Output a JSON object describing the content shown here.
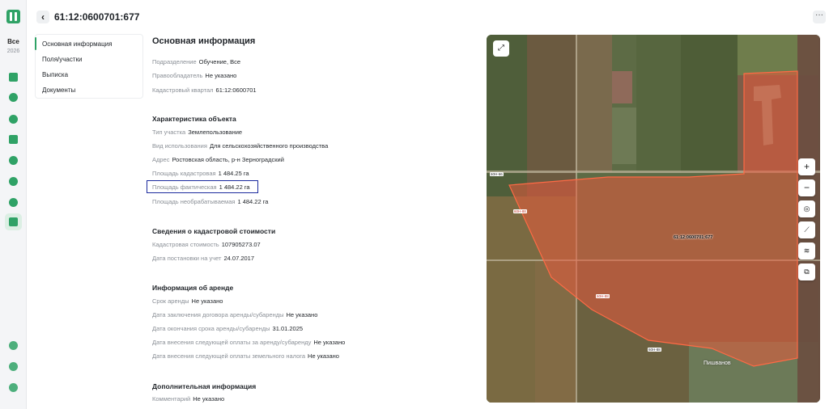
{
  "header": {
    "title": "61:12:0600701:677",
    "back_icon": "‹",
    "more_icon": "···"
  },
  "rail": {
    "all_label": "Все",
    "year": "2026",
    "icons": [
      "map-icon",
      "layers-icon",
      "machinery-icon",
      "report-icon",
      "crop-icon",
      "flower-icon",
      "analytics-icon",
      "land-icon",
      "settings-icon",
      "help-icon",
      "user-icon"
    ]
  },
  "sidenav": {
    "items": [
      {
        "label": "Основная информация",
        "active": true
      },
      {
        "label": "Поля/участки"
      },
      {
        "label": "Выписка"
      },
      {
        "label": "Документы"
      }
    ]
  },
  "main": {
    "title": "Основная информация",
    "general": [
      {
        "label": "Подразделение",
        "value": "Обучение, Все"
      },
      {
        "label": "Правообладатель",
        "value": "Не указано"
      },
      {
        "label": "Кадастровый квартал",
        "value": "61:12:0600701"
      }
    ],
    "characteristics": {
      "title": "Характеристика объекта",
      "rows": [
        {
          "label": "Тип участка",
          "value": "Землепользование"
        },
        {
          "label": "Вид использования",
          "value": "Для сельскохозяйственного производства"
        },
        {
          "label": "Адрес",
          "value": "Ростовская область, р-н Зерноградский"
        },
        {
          "label": "Площадь кадастровая",
          "value": "1 484.25 га"
        },
        {
          "label": "Площадь фактическая",
          "value": "1 484.22 га"
        },
        {
          "label": "Площадь необрабатываемая",
          "value": "1 484.22 га"
        }
      ]
    },
    "cadastral_value": {
      "title": "Сведения о кадастровой стоимости",
      "rows": [
        {
          "label": "Кадастровая стоимость",
          "value": "107905273.07"
        },
        {
          "label": "Дата постановки на учет",
          "value": "24.07.2017"
        }
      ]
    },
    "lease": {
      "title": "Информация об аренде",
      "rows": [
        {
          "label": "Срок аренды",
          "value": "Не указано"
        },
        {
          "label": "Дата заключения договора аренды/субаренды",
          "value": "Не указано"
        },
        {
          "label": "Дата окончания срока аренды/субаренды",
          "value": "31.01.2025"
        },
        {
          "label": "Дата внесения следующей оплаты за аренду/субаренду",
          "value": "Не указано"
        },
        {
          "label": "Дата внесения следующей оплаты земельного налога",
          "value": "Не указано"
        }
      ]
    },
    "additional": {
      "title": "Дополнительная информация",
      "rows": [
        {
          "label": "Комментарий",
          "value": "Не указано"
        }
      ]
    }
  },
  "map": {
    "parcel_label": "61:12:0600701:677",
    "town_label": "Пишванов",
    "road_tags": [
      "60Н-66",
      "60Н-88",
      "60Н-88",
      "60Н-88"
    ],
    "controls": {
      "zoom_in": "+",
      "zoom_out": "−"
    },
    "parcel_color": "#e8593c"
  }
}
